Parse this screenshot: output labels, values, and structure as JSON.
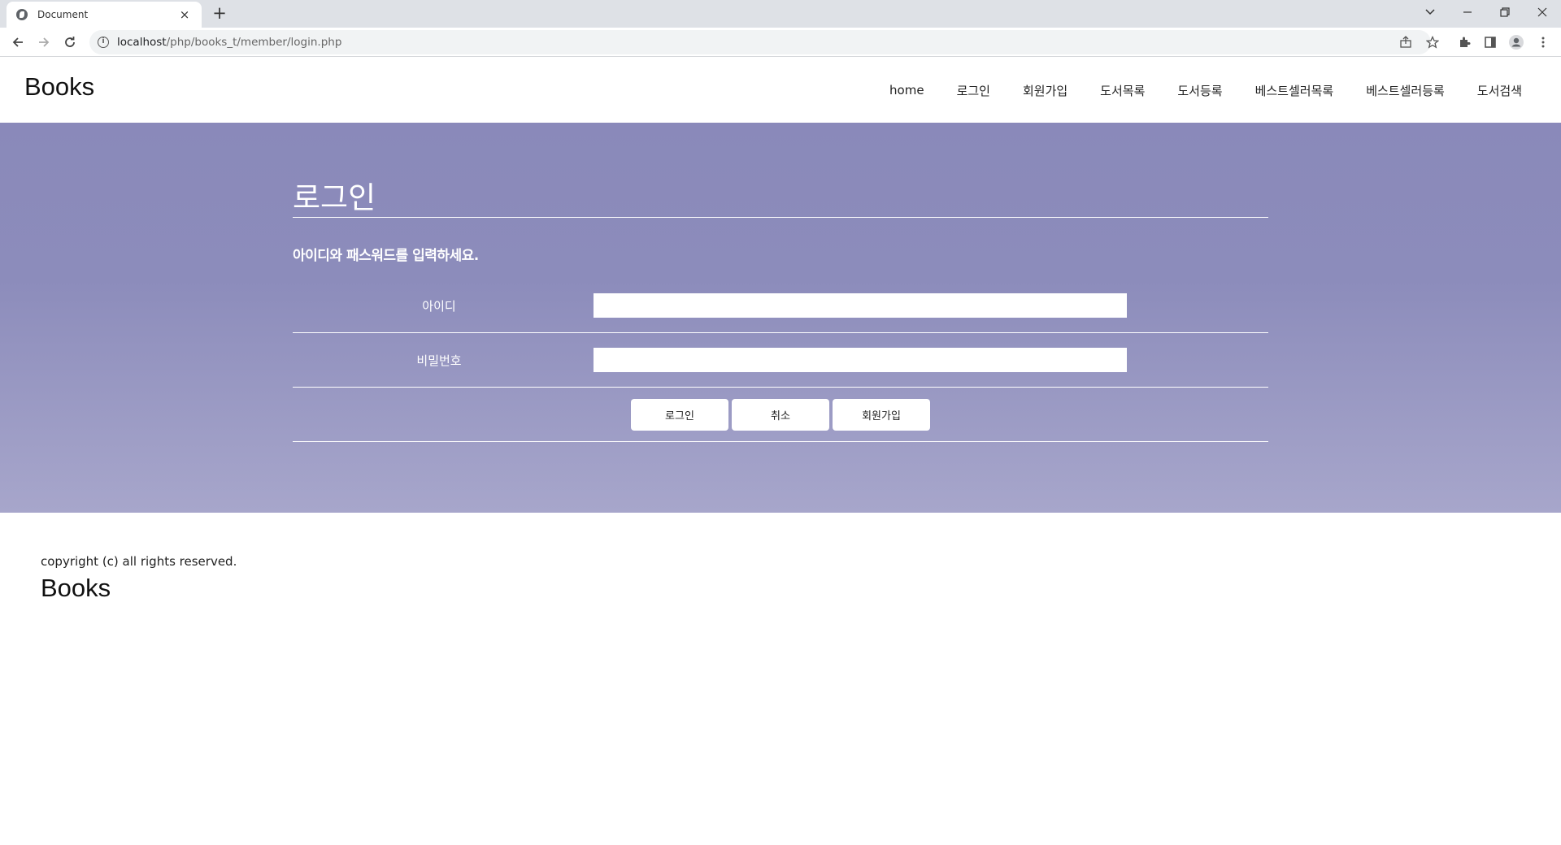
{
  "browser": {
    "tab_title": "Document",
    "tab_close": "×",
    "new_tab": "+",
    "url_host": "localhost",
    "url_path": "/php/books_t/member/login.php"
  },
  "site": {
    "logo": "Books",
    "nav": [
      "home",
      "로그인",
      "회원가입",
      "도서목록",
      "도서등록",
      "베스트셀러목록",
      "베스트셀러등록",
      "도서검색"
    ]
  },
  "login": {
    "title": "로그인",
    "subtitle": "아이디와 패스워드를 입력하세요.",
    "id_label": "아이디",
    "id_value": "",
    "pw_label": "비밀번호",
    "pw_value": "",
    "buttons": {
      "login": "로그인",
      "cancel": "취소",
      "join": "회원가입"
    }
  },
  "footer": {
    "copyright": "copyright (c) all rights reserved.",
    "logo": "Books"
  },
  "colors": {
    "hero_top": "#8a89ba",
    "hero_bottom": "#a7a6cb"
  }
}
